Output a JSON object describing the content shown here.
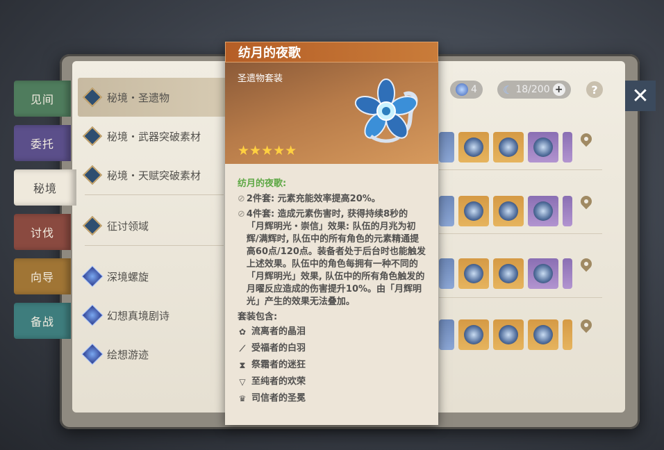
{
  "tabs": [
    {
      "label": "见间",
      "color": "#4f7c5d"
    },
    {
      "label": "委托",
      "color": "#5b4f8a"
    },
    {
      "label": "秘境",
      "color": "#efe9dc",
      "active": true
    },
    {
      "label": "讨伐",
      "color": "#8a4a40"
    },
    {
      "label": "向导",
      "color": "#a07535"
    },
    {
      "label": "备战",
      "color": "#3e7d7d"
    }
  ],
  "domains": [
    {
      "label": "秘境・圣遗物"
    },
    {
      "label": "秘境・武器突破素材"
    },
    {
      "label": "秘境・天赋突破素材"
    },
    {
      "label": "征讨领域"
    },
    {
      "label": "深境螺旋"
    },
    {
      "label": "幻想真境剧诗"
    },
    {
      "label": "绘想游迹"
    }
  ],
  "hud": {
    "resin_count": "4",
    "resin_capacity": "18/200",
    "plus": "+",
    "help": "?",
    "close": "✕"
  },
  "tooltip": {
    "title": "纺月的夜歌",
    "subtitle": "圣遗物套装",
    "stars": "★★★★★",
    "rarity": 5,
    "set_name": "纺月的夜歌:",
    "bonus2": "2件套: 元素充能效率提高20%。",
    "bonus4": "4件套: 造成元素伤害时, 获得持续8秒的「月辉明光・崇信」效果: 队伍的月兆为初辉/满辉时, 队伍中的所有角色的元素精通提高60点/120点。装备者处于后台时也能触发上述效果。队伍中的角色每拥有一种不同的「月辉明光」效果, 队伍中的所有角色触发的月曜反应造成的伤害提升10%。由「月辉明光」产生的效果无法叠加。",
    "includes_label": "套装包含:",
    "pieces": [
      {
        "icon": "flower-icon",
        "label": "流离者的晶泪"
      },
      {
        "icon": "plume-icon",
        "label": "受福者的白羽"
      },
      {
        "icon": "sands-icon",
        "label": "祭霜者的迷狂"
      },
      {
        "icon": "goblet-icon",
        "label": "至纯者的欢荣"
      },
      {
        "icon": "circlet-icon",
        "label": "司信者的圣冕"
      }
    ]
  }
}
